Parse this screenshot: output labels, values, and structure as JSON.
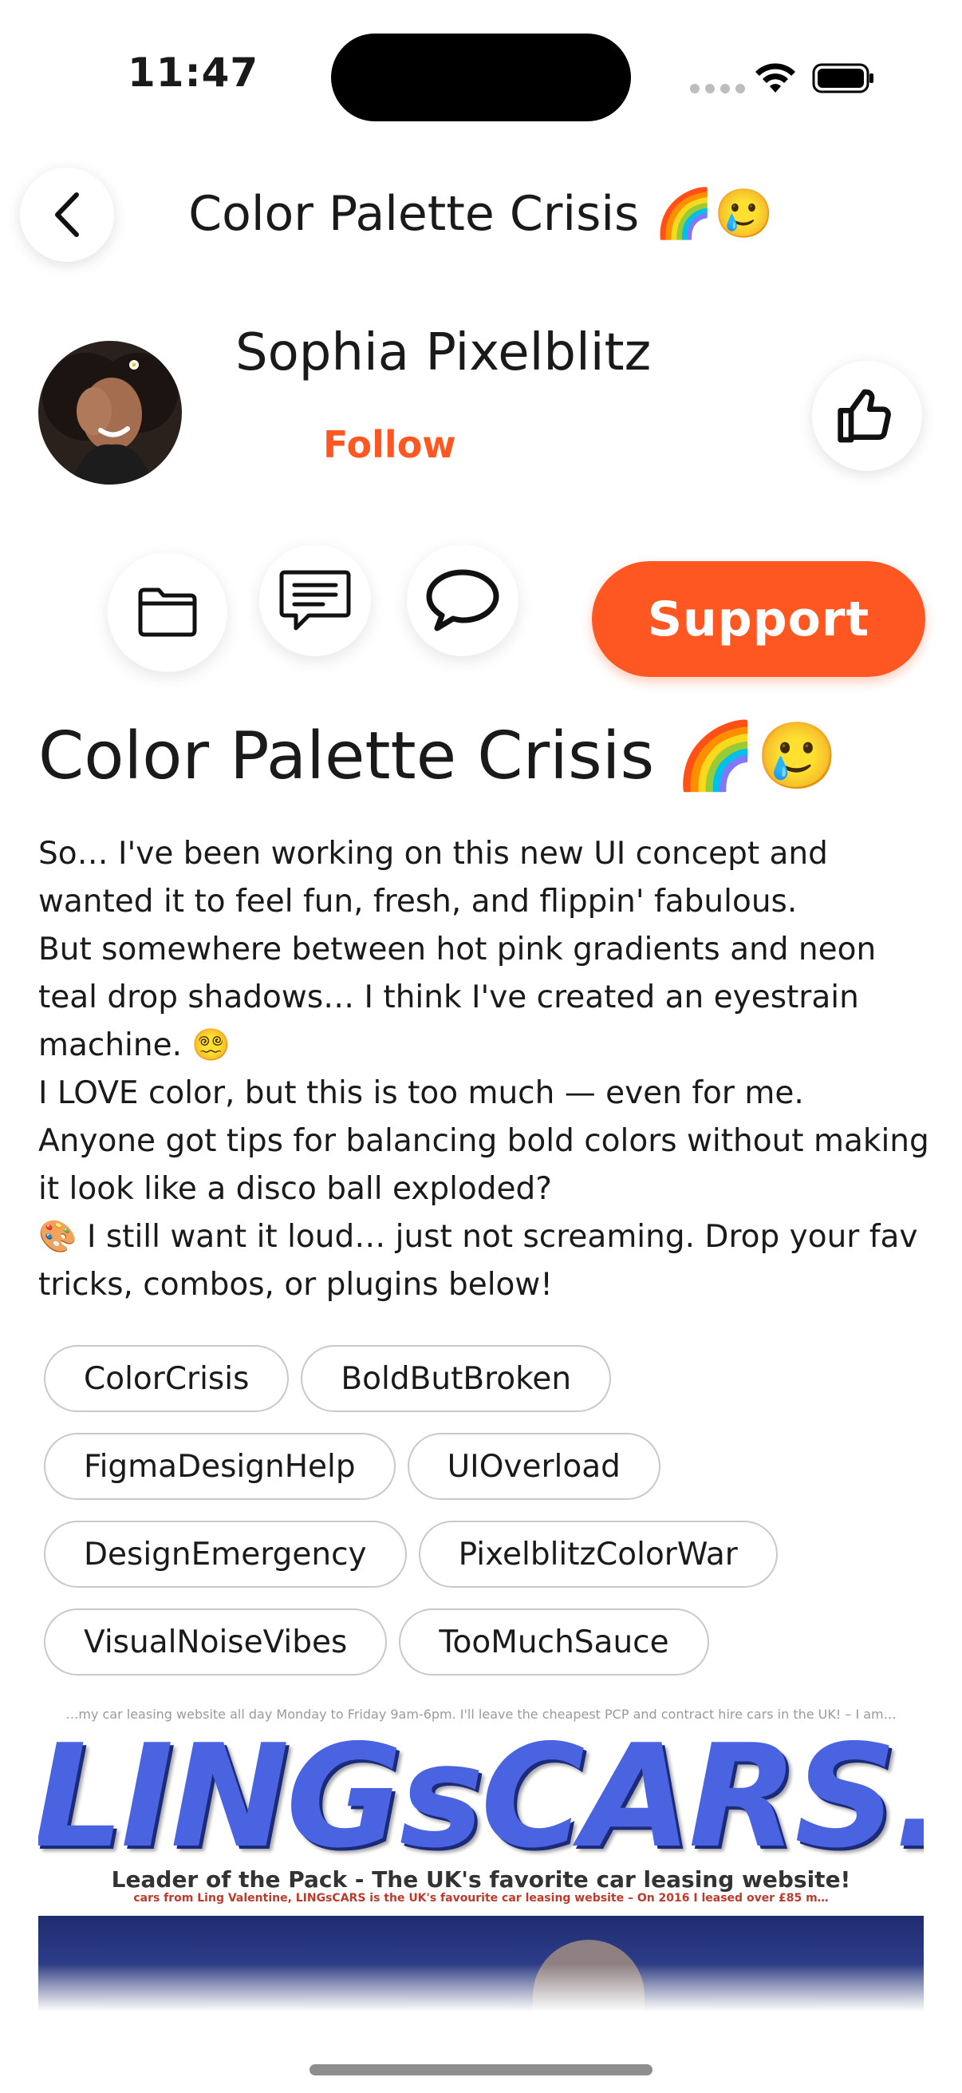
{
  "status_bar": {
    "time": "11:47"
  },
  "header": {
    "title": "Color Palette Crisis 🌈🥲"
  },
  "author": {
    "name": "Sophia Pixelblitz",
    "follow_label": "Follow"
  },
  "actions": {
    "support_label": "Support"
  },
  "post": {
    "title": "Color Palette Crisis 🌈🥲",
    "body": [
      "So… I've been working on this new UI concept and wanted it to feel fun, fresh, and flippin' fabulous.",
      "But somewhere between hot pink gradients and neon teal drop shadows… I think I've created an eyestrain machine. 😵‍💫",
      "I LOVE color, but this is too much — even for me.",
      "Anyone got tips for balancing bold colors without making it look like a disco ball exploded?",
      "🎨  I still want it loud… just not screaming. Drop your fav tricks, combos, or plugins below!"
    ],
    "tags": [
      "ColorCrisis",
      "BoldButBroken",
      "FigmaDesignHelp",
      "UIOverload",
      "DesignEmergency",
      "PixelblitzColorWar",
      "VisualNoiseVibes",
      "TooMuchSauce"
    ],
    "image": {
      "ticker": "…my car leasing website all day Monday to Friday 9am-6pm. I'll leave the cheapest PCP and contract hire cars in the UK! – I am…",
      "logo_text": "LINGsCARS.com",
      "tagline": "Leader of the Pack - The UK's favorite car leasing website!",
      "subline": "cars from Ling Valentine, LINGsCARS is the UK's favourite car leasing website – On 2016 I leased over £85 m…"
    }
  },
  "colors": {
    "accent": "#ff5722"
  }
}
